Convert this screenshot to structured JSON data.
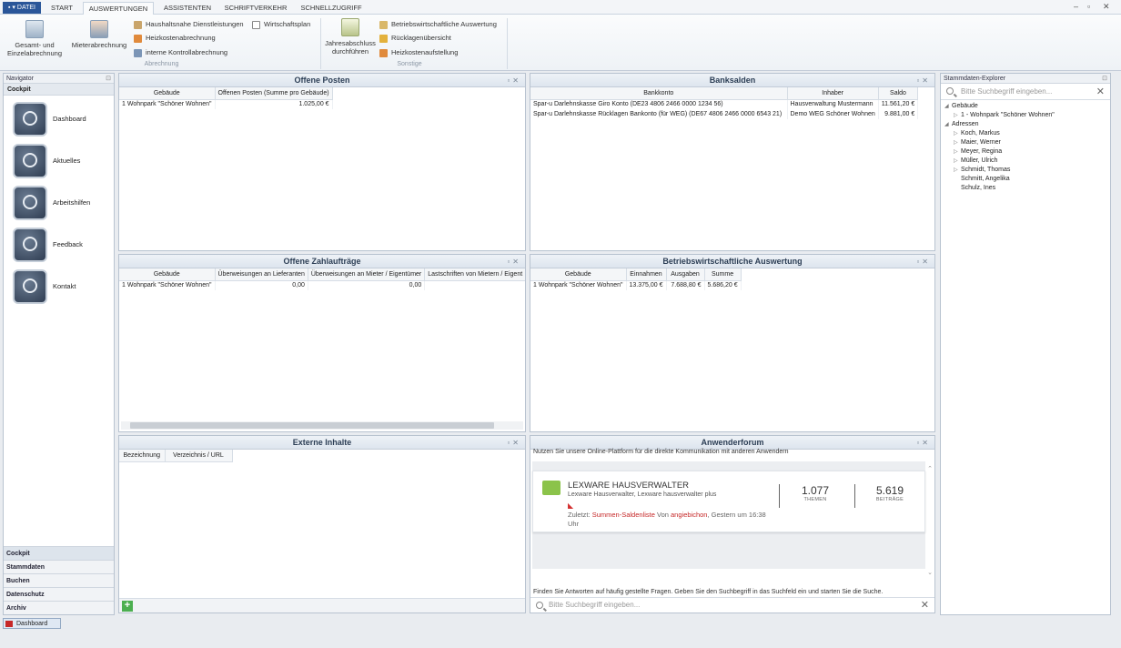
{
  "tabs": {
    "datei": "▪ ▾ DATEI",
    "items": [
      "START",
      "AUSWERTUNGEN",
      "ASSISTENTEN",
      "SCHRIFTVERKEHR",
      "SCHNELLZUGRIFF"
    ]
  },
  "window_controls": [
    "–",
    "▫",
    "✕"
  ],
  "ribbon": {
    "gesamt": "Gesamt- und Einzelabrechnung",
    "mieter": "Mieterabrechnung",
    "haushalt": "Haushaltsnahe Dienstleistungen",
    "wirtschaftsplan": "Wirtschaftsplan",
    "heizkosten": "Heizkostenabrechnung",
    "interne": "interne Kontrollabrechnung",
    "group_abrechnung": "Abrechnung",
    "jahresabschluss": "Jahresabschluss durchführen",
    "bwa": "Betriebswirtschaftliche Auswertung",
    "ruecklagen": "Rücklagenübersicht",
    "heizkostenauf": "Heizkostenaufstellung",
    "group_sonstige": "Sonstige"
  },
  "navigator": {
    "title": "Navigator",
    "section": "Cockpit",
    "items": [
      {
        "label": "Dashboard",
        "icon": "dashboard-icon"
      },
      {
        "label": "Aktuelles",
        "icon": "news-icon"
      },
      {
        "label": "Arbeitshilfen",
        "icon": "tools-icon"
      },
      {
        "label": "Feedback",
        "icon": "feedback-icon"
      },
      {
        "label": "Kontakt",
        "icon": "contact-icon"
      }
    ],
    "bottom": [
      "Cockpit",
      "Stammdaten",
      "Buchen",
      "Datenschutz",
      "Archiv"
    ]
  },
  "offene_posten": {
    "title": "Offene Posten",
    "headers": [
      "Gebäude",
      "Offenen Posten (Summe pro Gebäude)"
    ],
    "rows": [
      [
        "1 Wohnpark \"Schöner Wohnen\"",
        "1.025,00 €"
      ]
    ]
  },
  "banksalden": {
    "title": "Banksalden",
    "headers": [
      "Bankkonto",
      "Inhaber",
      "Saldo"
    ],
    "rows": [
      [
        "Spar-u Darlehnskasse Giro Konto (DE23 4806 2466 0000 1234 56)",
        "Hausverwaltung Mustermann",
        "11.561,20 €"
      ],
      [
        "Spar-u Darlehnskasse Rücklagen Bankonto  (für WEG) (DE67 4806 2466 0000 6543 21)",
        "Demo WEG Schöner Wohnen",
        "9.881,00 €"
      ]
    ]
  },
  "zahlauftraege": {
    "title": "Offene Zahlaufträge",
    "headers": [
      "Gebäude",
      "Überweisungen an Lieferanten",
      "Überweisungen an Mieter / Eigentümer",
      "Lastschriften von Mietern / Eigent"
    ],
    "rows": [
      [
        "1 Wohnpark \"Schöner Wohnen\"",
        "0,00",
        "0,00",
        ""
      ]
    ]
  },
  "bwa": {
    "title": "Betriebswirtschaftliche Auswertung",
    "headers": [
      "Gebäude",
      "Einnahmen",
      "Ausgaben",
      "Summe"
    ],
    "rows": [
      [
        "1 Wohnpark \"Schöner Wohnen\"",
        "13.375,00 €",
        "7.688,80 €",
        "5.686,20 €"
      ]
    ]
  },
  "externe": {
    "title": "Externe Inhalte",
    "headers": [
      "Bezeichnung",
      "Verzeichnis / URL"
    ]
  },
  "forum": {
    "title": "Anwenderforum",
    "intro": "Nutzen Sie unsere Online-Plattform für die direkte Kommunikation mit anderen Anwendern",
    "card_title": "LEXWARE HAUSVERWALTER",
    "card_sub": "Lexware Hausverwalter, Lexware hausverwalter plus",
    "last_prefix": "Zuletzt:",
    "last_link": "Summen-Saldenliste",
    "last_von": "Von",
    "last_user": "angiebichon",
    "last_time": ", Gestern um 16:38 Uhr",
    "themen": "1.077",
    "themen_lbl": "THEMEN",
    "beitraege": "5.619",
    "beitraege_lbl": "BEITRÄGE",
    "footer": "Finden Sie Antworten auf häufig gestellte Fragen. Geben Sie den Suchbegriff in das Suchfeld ein und starten Sie die Suche.",
    "search_placeholder": "Bitte Suchbegriff eingeben..."
  },
  "explorer": {
    "title": "Stammdaten-Explorer",
    "search_placeholder": "Bitte Suchbegriff eingeben...",
    "tree": [
      {
        "arrow": "◢",
        "label": "Gebäude",
        "level": 0
      },
      {
        "arrow": "▷",
        "label": "1 - Wohnpark \"Schöner Wohnen\"",
        "level": 1
      },
      {
        "arrow": "◢",
        "label": "Adressen",
        "level": 0
      },
      {
        "arrow": "▷",
        "label": "Koch, Markus",
        "level": 1
      },
      {
        "arrow": "▷",
        "label": "Maier, Werner",
        "level": 1
      },
      {
        "arrow": "▷",
        "label": "Meyer, Regina",
        "level": 1
      },
      {
        "arrow": "▷",
        "label": "Müller, Ulrich",
        "level": 1
      },
      {
        "arrow": "▷",
        "label": "Schmidt, Thomas",
        "level": 1
      },
      {
        "arrow": "",
        "label": "Schmitt, Angelika",
        "level": 1
      },
      {
        "arrow": "",
        "label": "Schulz, Ines",
        "level": 1
      }
    ]
  },
  "statusbar": {
    "tab": "Dashboard"
  }
}
